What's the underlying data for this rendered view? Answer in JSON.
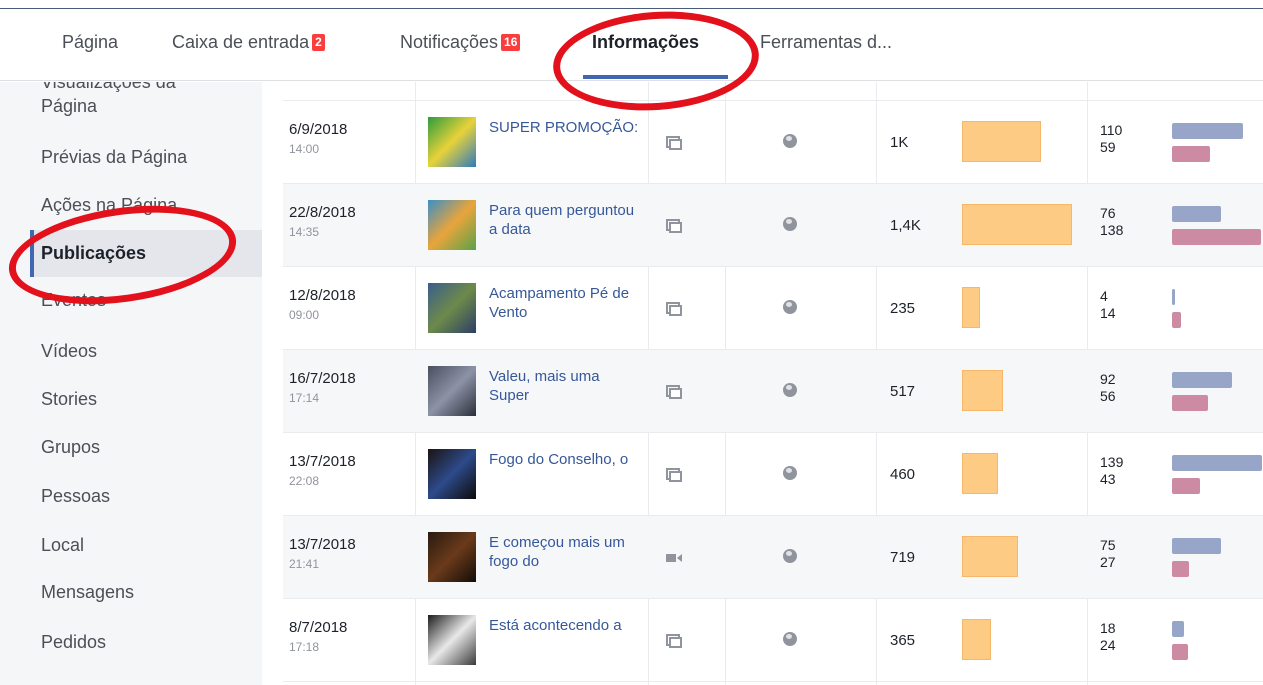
{
  "nav": {
    "items": [
      {
        "label": "Página",
        "badge": ""
      },
      {
        "label": "Caixa de entrada",
        "badge": "2"
      },
      {
        "label": "Notificações",
        "badge": "16"
      },
      {
        "label": "Informações",
        "badge": ""
      },
      {
        "label": "Ferramentas d...",
        "badge": ""
      }
    ]
  },
  "sidebar": {
    "cut_label": "Visualizações da",
    "items": [
      {
        "label": "Página"
      },
      {
        "label": "Prévias da Página"
      },
      {
        "label": "Ações na Página"
      },
      {
        "label": "Publicações"
      },
      {
        "label": "Eventos"
      },
      {
        "label": "Vídeos"
      },
      {
        "label": "Stories"
      },
      {
        "label": "Grupos"
      },
      {
        "label": "Pessoas"
      },
      {
        "label": "Local"
      },
      {
        "label": "Mensagens"
      },
      {
        "label": "Pedidos"
      }
    ],
    "active": "Publicações"
  },
  "posts": [
    {
      "date": "6/9/2018",
      "time": "14:00",
      "title": "SUPER PROMOÇÃO:",
      "type": "post",
      "reach": "1K",
      "reach_value": 1000,
      "clicks": "110",
      "reactions": "59",
      "clicks_value": 110,
      "reactions_value": 59
    },
    {
      "date": "22/8/2018",
      "time": "14:35",
      "title": "Para quem perguntou a data",
      "type": "post",
      "reach": "1,4K",
      "reach_value": 1400,
      "clicks": "76",
      "reactions": "138",
      "clicks_value": 76,
      "reactions_value": 138
    },
    {
      "date": "12/8/2018",
      "time": "09:00",
      "title": "Acampamento Pé de Vento",
      "type": "post",
      "reach": "235",
      "reach_value": 235,
      "clicks": "4",
      "reactions": "14",
      "clicks_value": 4,
      "reactions_value": 14
    },
    {
      "date": "16/7/2018",
      "time": "17:14",
      "title": "Valeu, mais uma Super",
      "type": "post",
      "reach": "517",
      "reach_value": 517,
      "clicks": "92",
      "reactions": "56",
      "clicks_value": 92,
      "reactions_value": 56
    },
    {
      "date": "13/7/2018",
      "time": "22:08",
      "title": "Fogo do Conselho, o",
      "type": "post",
      "reach": "460",
      "reach_value": 460,
      "clicks": "139",
      "reactions": "43",
      "clicks_value": 139,
      "reactions_value": 43
    },
    {
      "date": "13/7/2018",
      "time": "21:41",
      "title": "E começou mais um fogo do",
      "type": "video",
      "reach": "719",
      "reach_value": 719,
      "clicks": "75",
      "reactions": "27",
      "clicks_value": 75,
      "reactions_value": 27
    },
    {
      "date": "8/7/2018",
      "time": "17:18",
      "title": "Está acontecendo a",
      "type": "post",
      "reach": "365",
      "reach_value": 365,
      "clicks": "18",
      "reactions": "24",
      "clicks_value": 18,
      "reactions_value": 24
    }
  ],
  "colors": {
    "accent": "#4267b2",
    "reach_bar": "#fecb84",
    "clicks_bar": "#97a6c8",
    "reactions_bar": "#cc8aa3",
    "annotation": "#e3111b"
  }
}
